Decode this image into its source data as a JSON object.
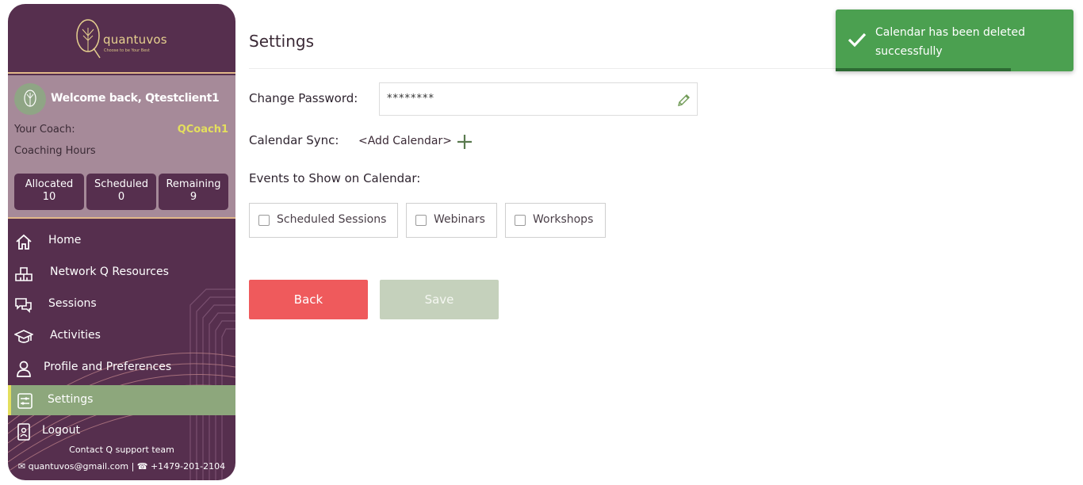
{
  "sidebar": {
    "logo_text": "quantuvos",
    "logo_tagline": "Choose to be Your Best",
    "welcome": "Welcome back, Qtestclient1",
    "coach_label": "Your Coach:",
    "coach_name": "QCoach1",
    "hours_label": "Coaching Hours",
    "hours": [
      {
        "label": "Allocated",
        "value": "10"
      },
      {
        "label": "Scheduled",
        "value": "0"
      },
      {
        "label": "Remaining",
        "value": "9"
      }
    ],
    "nav": [
      {
        "label": "Home",
        "icon": "home-icon"
      },
      {
        "label": "Network Q Resources",
        "icon": "network-icon"
      },
      {
        "label": "Sessions",
        "icon": "chat-icon"
      },
      {
        "label": "Activities",
        "icon": "graduation-cap-icon"
      },
      {
        "label": "Profile and Preferences",
        "icon": "user-icon"
      },
      {
        "label": "Settings",
        "icon": "settings-sliders-icon",
        "active": true
      },
      {
        "label": "Logout",
        "icon": "logout-badge-icon"
      }
    ],
    "contact_title": "Contact Q support team",
    "contact_email": "quantuvos@gmail.com",
    "contact_phone": "+1479-201-2104"
  },
  "main": {
    "title": "Settings",
    "change_password_label": "Change Password:",
    "password_value": "********",
    "calendar_sync_label": "Calendar Sync:",
    "add_calendar_label": "<Add Calendar>",
    "events_label": "Events to Show on Calendar:",
    "events": [
      {
        "label": "Scheduled Sessions",
        "checked": false
      },
      {
        "label": "Webinars",
        "checked": false
      },
      {
        "label": "Workshops",
        "checked": false
      }
    ],
    "back_label": "Back",
    "save_label": "Save"
  },
  "toast": {
    "message": "Calendar has been deleted successfully"
  },
  "colors": {
    "sidebar_bg": "#562f4e",
    "profile_bg": "#a68a99",
    "active_nav": "#8da77c",
    "accent_yellow": "#e4df5d",
    "back_button": "#ef5a5c",
    "save_button_disabled": "#c5d1bc",
    "toast_bg": "#4ba050"
  }
}
